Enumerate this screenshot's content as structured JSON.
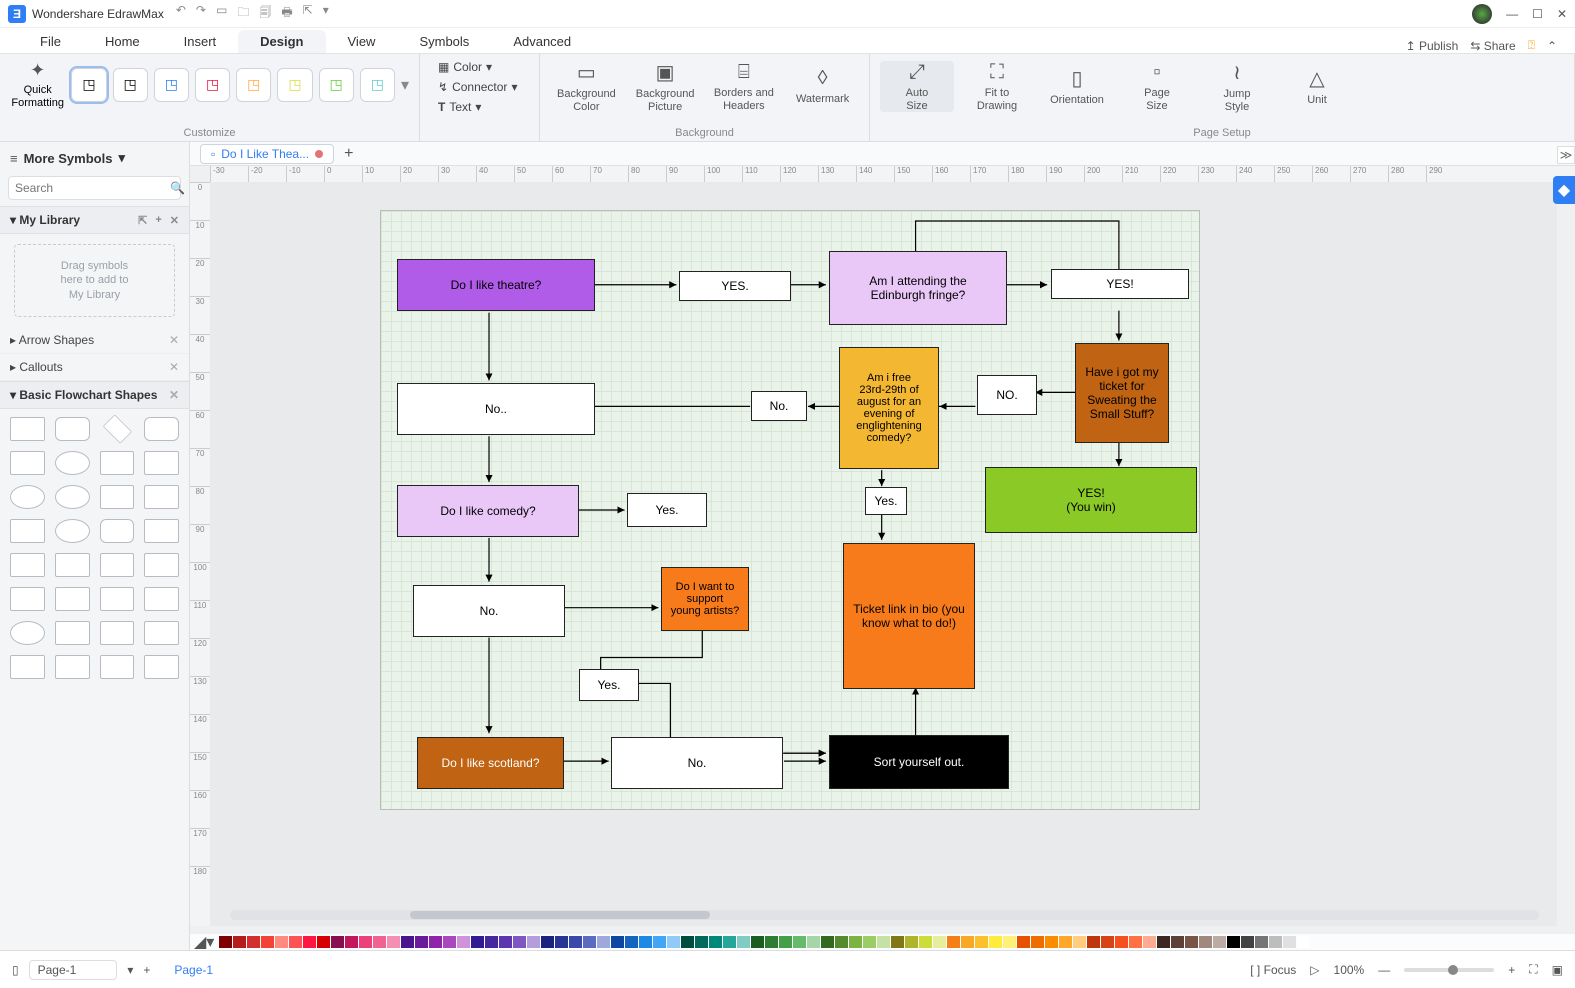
{
  "app": {
    "title": "Wondershare EdrawMax"
  },
  "titlebar_tools": [
    "↶",
    "↷",
    "▭",
    "🗀",
    "🗐",
    "🖶",
    "⇱",
    "▾"
  ],
  "win_controls": [
    "—",
    "☐",
    "✕"
  ],
  "menu": {
    "items": [
      "File",
      "Home",
      "Insert",
      "Design",
      "View",
      "Symbols",
      "Advanced"
    ],
    "active": "Design"
  },
  "menu_right": {
    "publish": "Publish",
    "share": "Share"
  },
  "ribbon": {
    "quick_formatting": "Quick\nFormatting",
    "customize_label": "Customize",
    "mini_color": "Color",
    "mini_connector": "Connector",
    "mini_text": "Text",
    "bg": {
      "color": "Background\nColor",
      "picture": "Background\nPicture",
      "borders": "Borders and\nHeaders",
      "watermark": "Watermark",
      "label": "Background"
    },
    "ps": {
      "autosize": "Auto\nSize",
      "fit": "Fit to\nDrawing",
      "orientation": "Orientation",
      "pagesize": "Page\nSize",
      "jump": "Jump\nStyle",
      "unit": "Unit",
      "label": "Page Setup"
    }
  },
  "left": {
    "more_symbols": "More Symbols",
    "search_placeholder": "Search",
    "my_library": "My Library",
    "placeholder": "Drag symbols\nhere to add to\nMy Library",
    "arrow_shapes": "Arrow Shapes",
    "callouts": "Callouts",
    "basic_flowchart": "Basic Flowchart Shapes"
  },
  "document": {
    "tab_name": "Do I Like Thea...",
    "dirty": true
  },
  "ruler_h": [
    "-30",
    "-20",
    "-10",
    "0",
    "10",
    "20",
    "30",
    "40",
    "50",
    "60",
    "70",
    "80",
    "90",
    "100",
    "110",
    "120",
    "130",
    "140",
    "150",
    "160",
    "170",
    "180",
    "190",
    "200",
    "210",
    "220",
    "230",
    "240",
    "250",
    "260",
    "270",
    "280",
    "290"
  ],
  "ruler_v": [
    "0",
    "10",
    "20",
    "30",
    "40",
    "50",
    "60",
    "70",
    "80",
    "90",
    "100",
    "110",
    "120",
    "130",
    "140",
    "150",
    "160",
    "170",
    "180"
  ],
  "flow": {
    "n_theatre": "Do I like theatre?",
    "n_yes1": "YES.",
    "n_edin": "Am I attending the\nEdinburgh fringe?",
    "n_yes2": "YES!",
    "n_ticket": "Have i got my\nticket for\nSweating the\nSmall Stuff?",
    "n_no_top": "NO.",
    "n_free": "Am i free\n23rd-29th of\naugust for an\nevening of\nenglightening\ncomedy?",
    "n_no1": "No..",
    "n_noinner": "No.",
    "n_comedy": "Do I like comedy?",
    "n_yes3": "Yes.",
    "n_yes4": "Yes.",
    "n_win": "YES!\n(You win)",
    "n_no2": "No.",
    "n_young": "Do I want to\nsupport\nyoung artists?",
    "n_link": "Ticket link in bio (you\nknow what to do!)",
    "n_yes5": "Yes.",
    "n_scot": "Do I like scotland?",
    "n_no3": "No.",
    "n_sort": "Sort yourself out."
  },
  "color_swatches": [
    "#7f0000",
    "#b71c1c",
    "#d32f2f",
    "#f44336",
    "#ff8a80",
    "#ff5252",
    "#ff1744",
    "#d50000",
    "#880e4f",
    "#c2185b",
    "#ec407a",
    "#f06292",
    "#f48fb1",
    "#4a148c",
    "#6a1b9a",
    "#8e24aa",
    "#ab47bc",
    "#ce93d8",
    "#311b92",
    "#4527a0",
    "#5e35b1",
    "#7e57c2",
    "#b39ddb",
    "#1a237e",
    "#283593",
    "#3949ab",
    "#5c6bc0",
    "#9fa8da",
    "#0d47a1",
    "#1565c0",
    "#1e88e5",
    "#42a5f5",
    "#90caf9",
    "#004d40",
    "#00695c",
    "#00897b",
    "#26a69a",
    "#80cbc4",
    "#1b5e20",
    "#2e7d32",
    "#43a047",
    "#66bb6a",
    "#a5d6a7",
    "#33691e",
    "#558b2f",
    "#7cb342",
    "#9ccc65",
    "#c5e1a5",
    "#827717",
    "#afb42b",
    "#cddc39",
    "#e6ee9c",
    "#f57f17",
    "#f9a825",
    "#fbc02d",
    "#ffeb3b",
    "#fff176",
    "#e65100",
    "#ef6c00",
    "#fb8c00",
    "#ffa726",
    "#ffcc80",
    "#bf360c",
    "#d84315",
    "#f4511e",
    "#ff7043",
    "#ffab91",
    "#3e2723",
    "#5d4037",
    "#795548",
    "#a1887f",
    "#bcaaa4",
    "#000000",
    "#424242",
    "#757575",
    "#bdbdbd",
    "#e0e0e0",
    "#ffffff"
  ],
  "status": {
    "page_dropdown": "Page-1",
    "page_link": "Page-1",
    "focus": "Focus",
    "zoom": "100%"
  }
}
